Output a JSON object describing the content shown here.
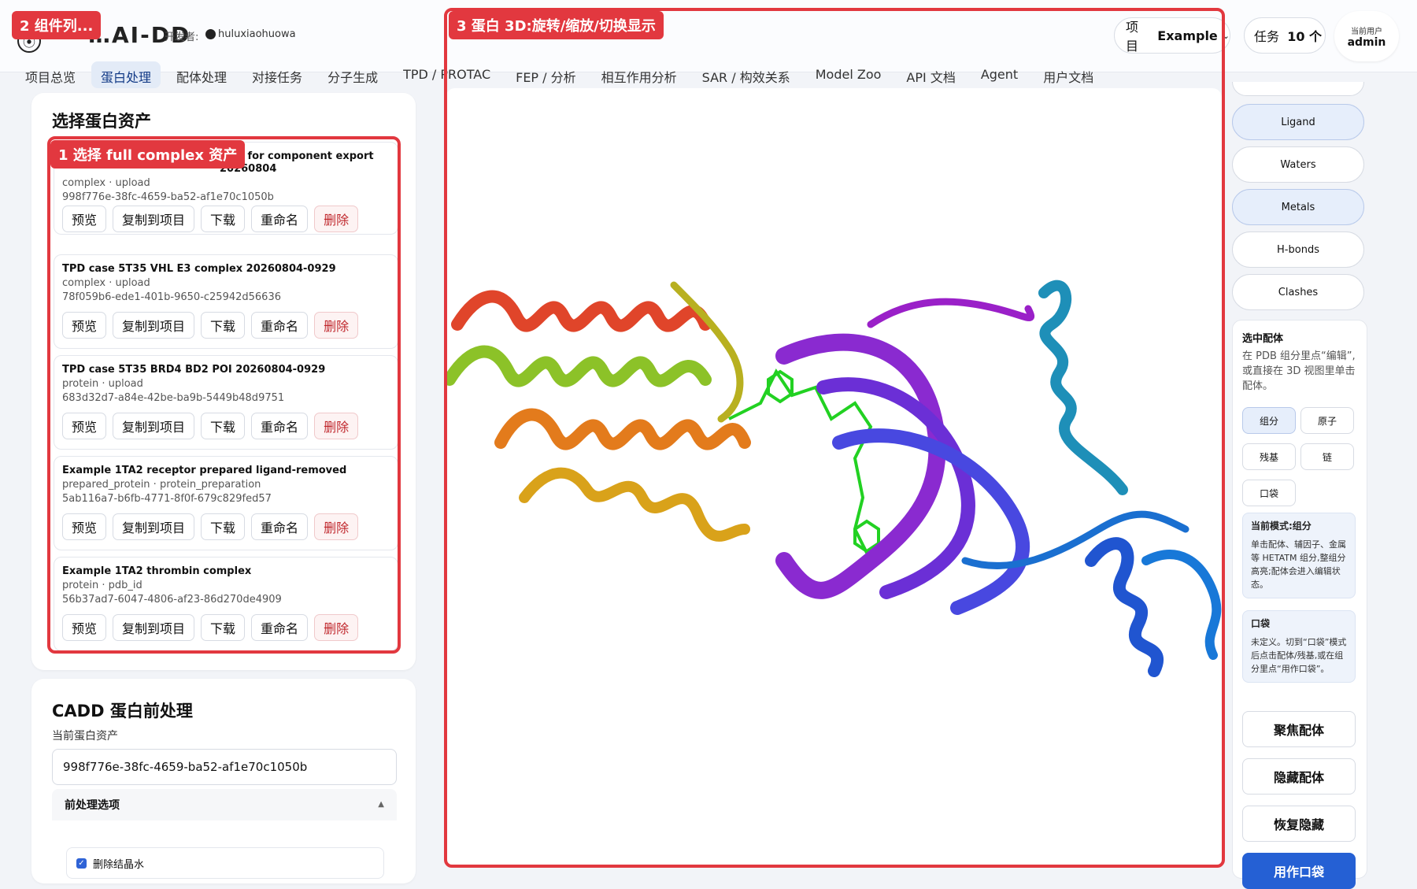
{
  "header": {
    "logo_text": "…AI-DD",
    "developer_label": "开发者:",
    "developer_name": "huluxiaohuowa",
    "project_label": "项目",
    "project_value": "Example",
    "task_label": "任务",
    "task_value": "10 个",
    "user_label": "当前用户",
    "user_name": "admin"
  },
  "nav": {
    "items": [
      {
        "label": "项目总览"
      },
      {
        "label": "蛋白处理"
      },
      {
        "label": "配体处理"
      },
      {
        "label": "对接任务"
      },
      {
        "label": "分子生成"
      },
      {
        "label": "TPD / PROTAC"
      },
      {
        "label": "FEP / 分析"
      },
      {
        "label": "相互作用分析"
      },
      {
        "label": "SAR / 构效关系"
      },
      {
        "label": "Model Zoo"
      },
      {
        "label": "API 文档"
      },
      {
        "label": "Agent"
      },
      {
        "label": "用户文档"
      }
    ]
  },
  "assets_panel": {
    "title": "选择蛋白资产",
    "buttons": {
      "preview": "预览",
      "copy": "复制到项目",
      "download": "下载",
      "rename": "重命名",
      "delete": "删除"
    },
    "items": [
      {
        "title": "plex for component export 20260804",
        "meta": "complex · upload",
        "id": "998f776e-38fc-4659-ba52-af1e70c1050b"
      },
      {
        "title": "TPD case 5T35 VHL E3 complex 20260804-0929",
        "meta": "complex · upload",
        "id": "78f059b6-ede1-401b-9650-c25942d56636"
      },
      {
        "title": "TPD case 5T35 BRD4 BD2 POI 20260804-0929",
        "meta": "protein · upload",
        "id": "683d32d7-a84e-42be-ba9b-5449b48d9751"
      },
      {
        "title": "Example 1TA2 receptor prepared ligand-removed",
        "meta": "prepared_protein · protein_preparation",
        "id": "5ab116a7-b6fb-4771-8f0f-679c829fed57"
      },
      {
        "title": "Example 1TA2 thrombin complex",
        "meta": "protein · pdb_id",
        "id": "56b37ad7-6047-4806-af23-86d270de4909"
      }
    ]
  },
  "cadd_panel": {
    "title": "CADD 蛋白前处理",
    "current_label": "当前蛋白资产",
    "current_value": "998f776e-38fc-4659-ba52-af1e70c1050b",
    "options_label": "前处理选项",
    "option_remove_water": "删除结晶水"
  },
  "right_panel": {
    "toggles": [
      {
        "label": "Ligand",
        "on": true
      },
      {
        "label": "Waters",
        "on": false
      },
      {
        "label": "Metals",
        "on": true
      },
      {
        "label": "H-bonds",
        "on": false
      },
      {
        "label": "Clashes",
        "on": false
      }
    ],
    "selected_title": "选中配体",
    "selected_desc": "在 PDB 组分里点“编辑”,或直接在 3D 视图里单击配体。",
    "modes": {
      "group": "组分",
      "atom": "原子",
      "residue": "残基",
      "chain": "链",
      "pocket": "口袋"
    },
    "mode_info_title": "当前模式:组分",
    "mode_info_text": "单击配体、辅因子、金属等 HETATM 组分,整组分高亮;配体会进入编辑状态。",
    "pocket_title": "口袋",
    "pocket_text": "未定义。切到“口袋”模式后点击配体/残基,或在组分里点“用作口袋”。",
    "actions": {
      "focus": "聚焦配体",
      "hide": "隐藏配体",
      "restore": "恢复隐藏",
      "use_pocket": "用作口袋"
    }
  },
  "annotations": {
    "tag1": "1 选择 full complex 资产",
    "tag2": "2 组件列...",
    "tag3": "3 蛋白 3D:旋转/缩放/切换显示"
  },
  "colors": {
    "accent": "#2560d4",
    "annotation": "#e2383f",
    "danger": "#c0282d"
  }
}
